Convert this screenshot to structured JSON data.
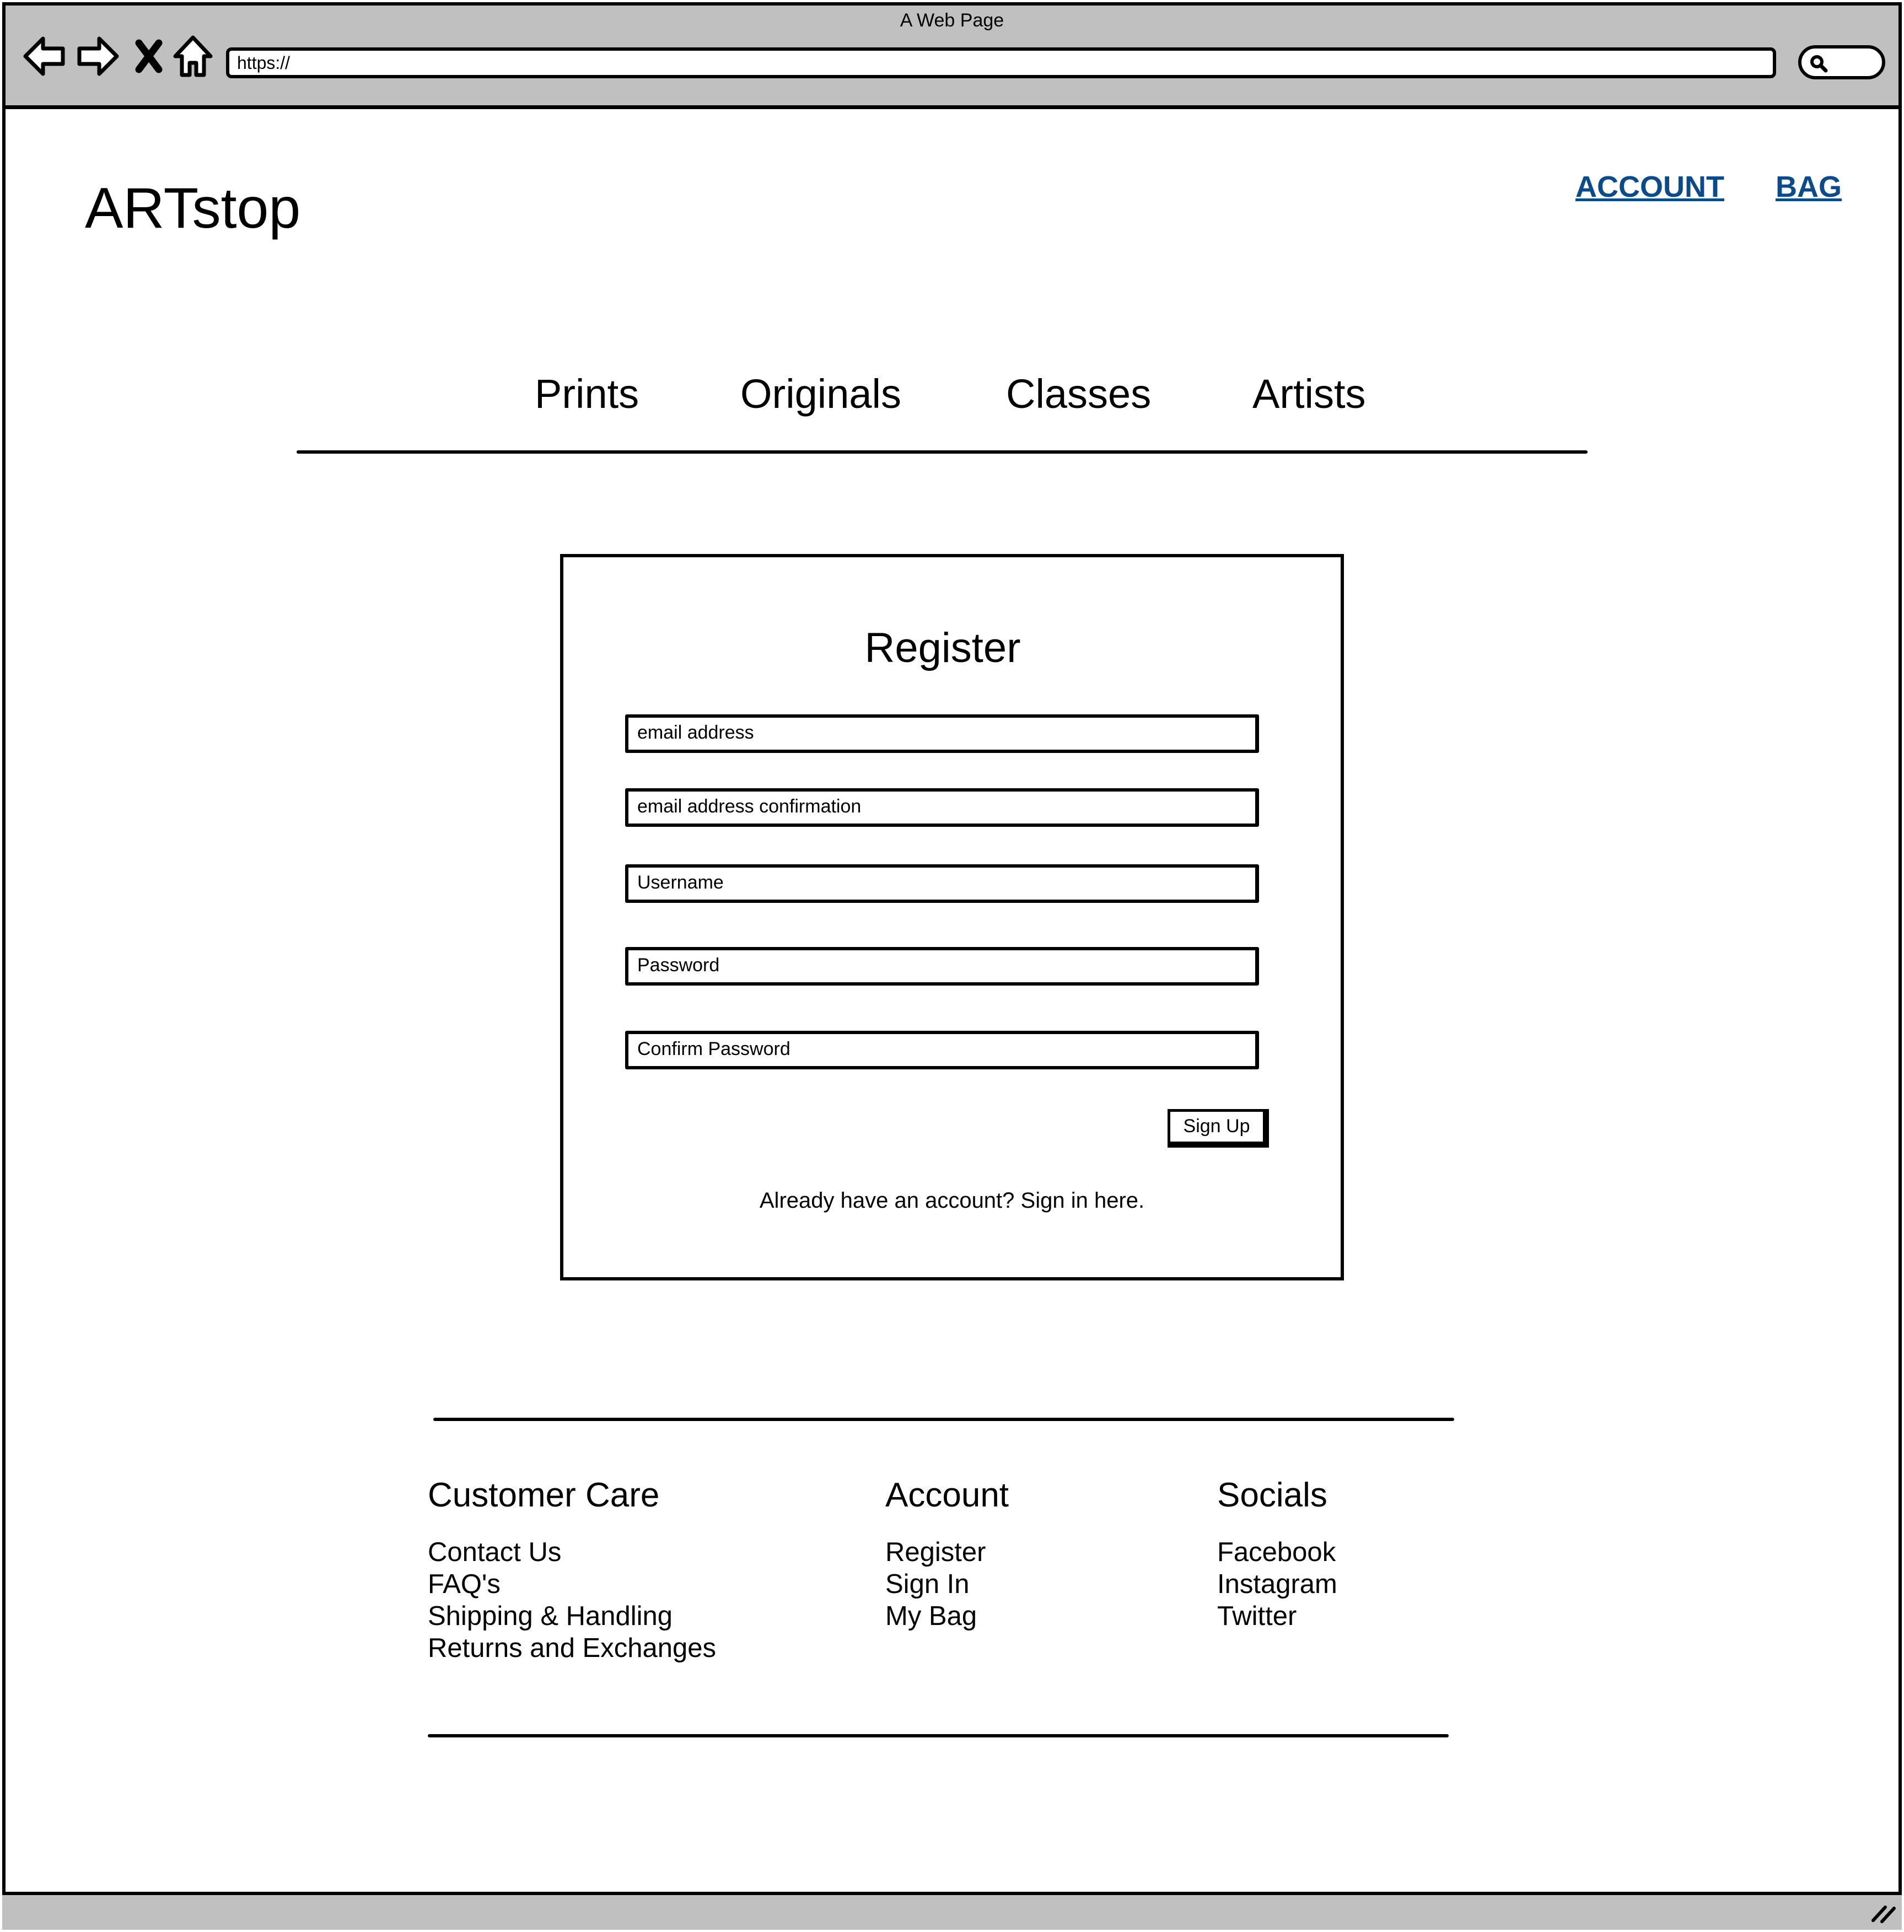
{
  "browser": {
    "window_title": "A Web Page",
    "url": "https://"
  },
  "header": {
    "logo": "ARTstop",
    "links": [
      "ACCOUNT",
      "BAG"
    ]
  },
  "nav": {
    "categories": [
      "Prints",
      "Originals",
      "Classes",
      "Artists"
    ]
  },
  "register": {
    "title": "Register",
    "fields": [
      "email address",
      "email address confirmation",
      "Username",
      "Password",
      "Confirm Password"
    ],
    "submit_label": "Sign Up",
    "signin_prompt": "Already have an account? Sign in here."
  },
  "footer": {
    "columns": [
      {
        "heading": "Customer Care",
        "links": [
          "Contact Us",
          "FAQ's",
          "Shipping & Handling",
          "Returns and Exchanges"
        ]
      },
      {
        "heading": "Account",
        "links": [
          "Register",
          "Sign In",
          "My Bag"
        ]
      },
      {
        "heading": "Socials",
        "links": [
          "Facebook",
          "Instagram",
          "Twitter"
        ]
      }
    ]
  },
  "colors": {
    "chrome": "#c0c0c0",
    "link": "#0b4a8b",
    "ink": "#000000"
  }
}
